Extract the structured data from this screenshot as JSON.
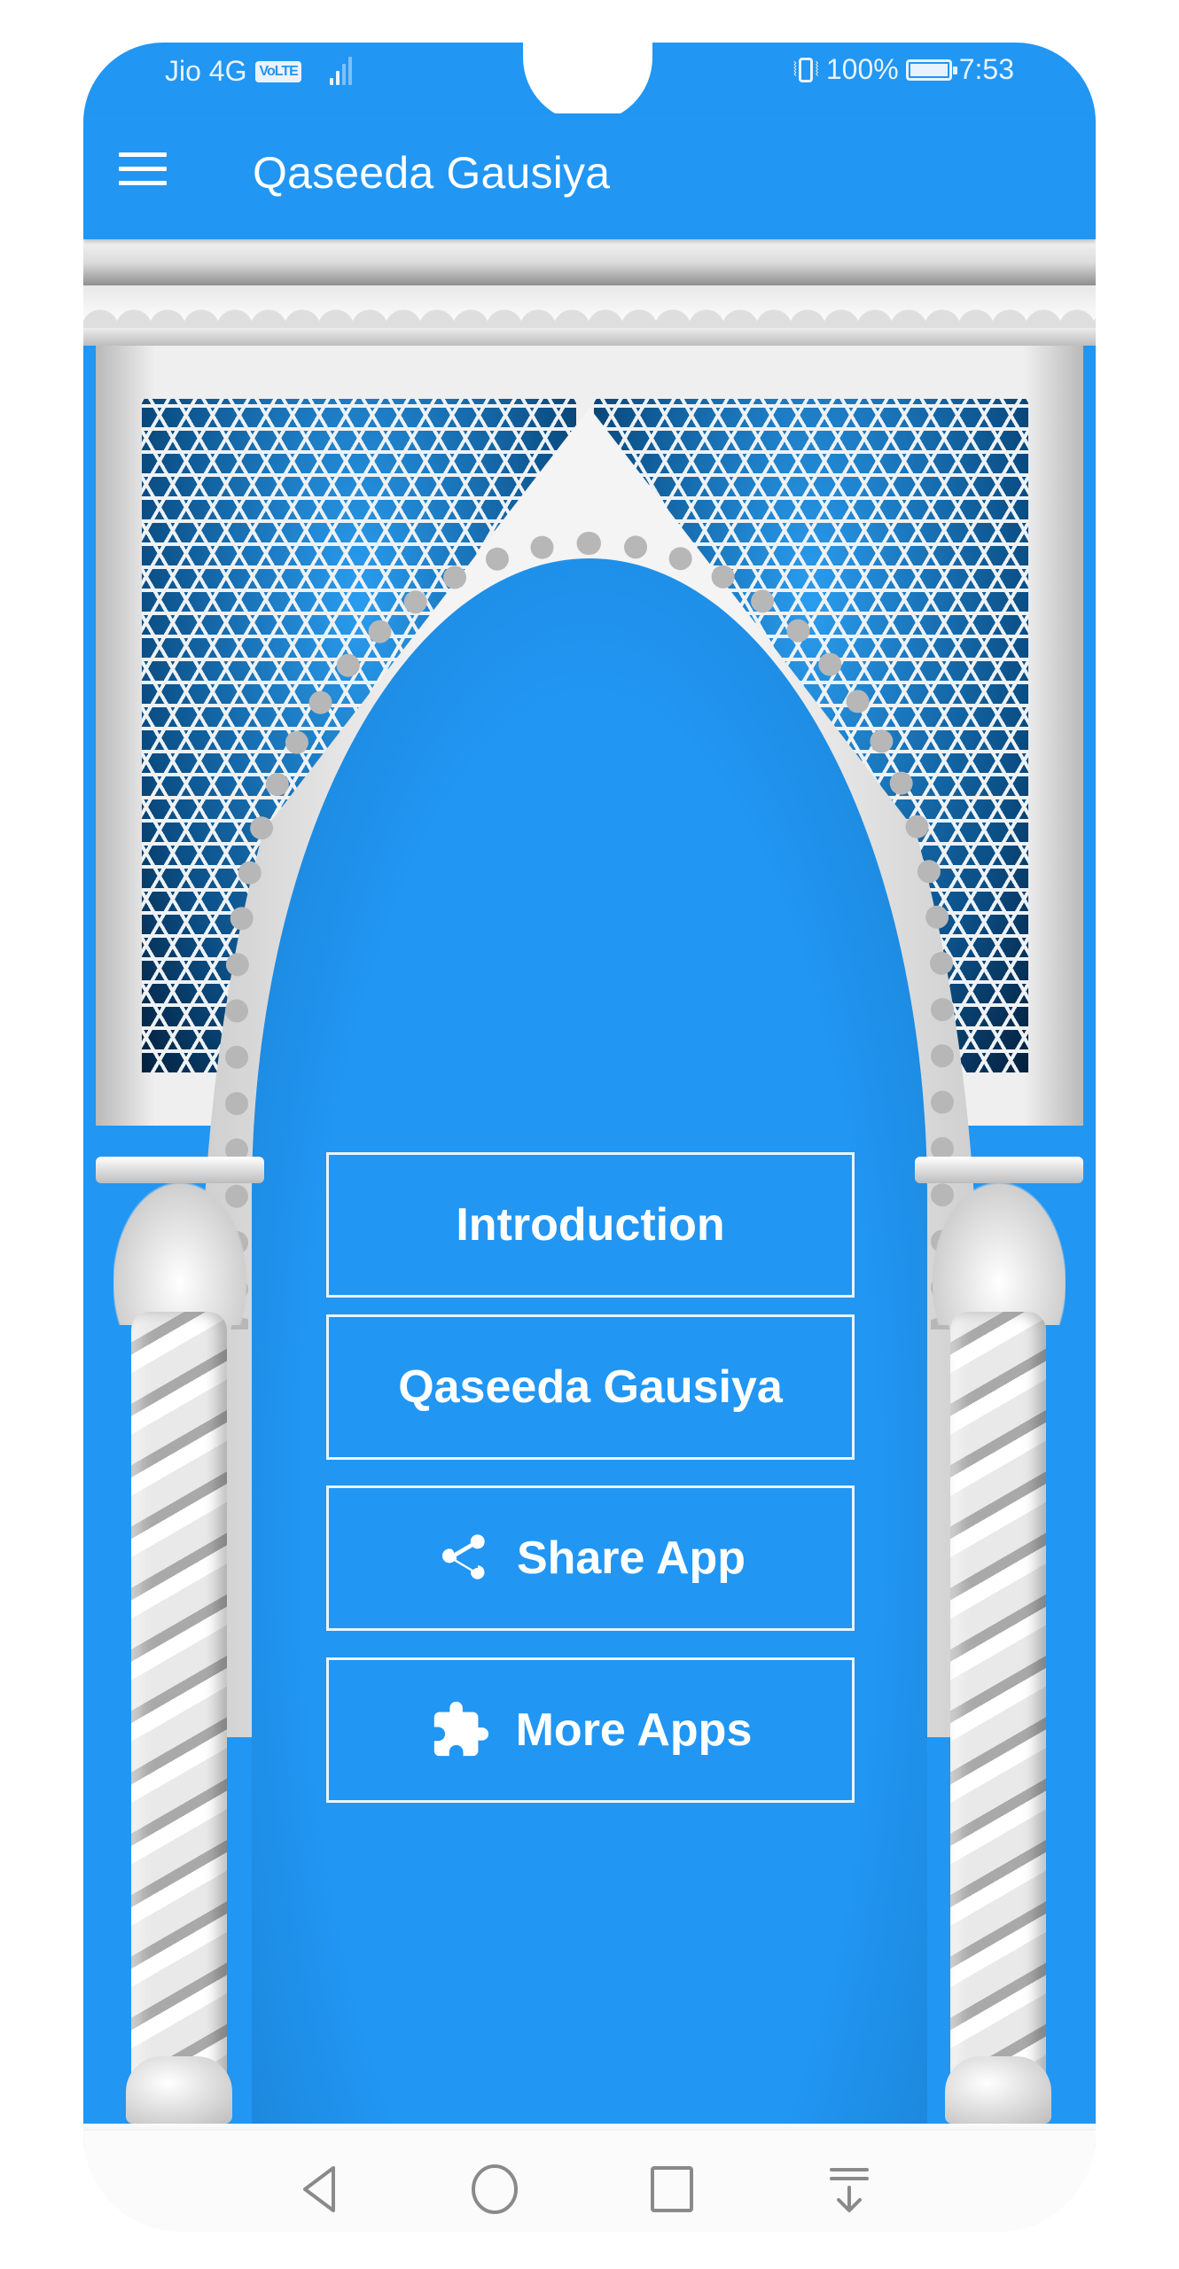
{
  "status_bar": {
    "carrier": "Jio 4G",
    "volte_badge": "VoLTE",
    "signal_bars": 2,
    "signal_bars_total": 4,
    "battery_percent": "100%",
    "battery_level": 1.0,
    "time": "7:53",
    "icons": [
      "vibrate-icon",
      "battery-icon",
      "signal-icon"
    ]
  },
  "app_bar": {
    "menu_icon": "hamburger-menu-icon",
    "title": "Qaseeda Gausiya"
  },
  "menu": {
    "items": [
      {
        "label": "Introduction",
        "icon": null
      },
      {
        "label": "Qaseeda Gausiya",
        "icon": null
      },
      {
        "label": "Share App",
        "icon": "share-icon"
      },
      {
        "label": "More Apps",
        "icon": "puzzle-piece-icon"
      }
    ]
  },
  "nav_bar": {
    "buttons": [
      "back",
      "home",
      "recents",
      "notification-pull-down"
    ]
  },
  "colors": {
    "primary": "#2196f3",
    "button_border": "#eaf4fe",
    "nav_icon": "#8a8a8a"
  }
}
